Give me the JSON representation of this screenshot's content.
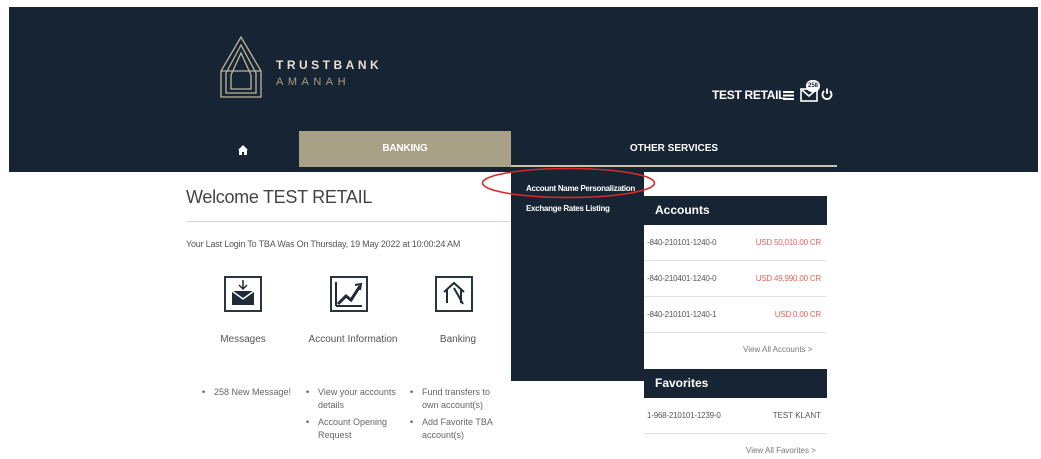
{
  "brand": {
    "line1": "TRUSTBANK",
    "line2": "AMANAH"
  },
  "header": {
    "user_name": "TEST RETAIL",
    "mail_count": "258"
  },
  "nav": {
    "banking": "BANKING",
    "other_services": "OTHER SERVICES"
  },
  "dropdown": {
    "items": [
      "Account Name Personalization",
      "Exchange Rates Listing"
    ]
  },
  "welcome": {
    "title": "Welcome TEST RETAIL",
    "last_login": "Your Last Login To TBA Was On Thursday, 19 May 2022 at 10:00:24 AM"
  },
  "tiles": [
    {
      "label": "Messages",
      "icon": "messages-icon",
      "bullets": [
        "258 New Message!"
      ]
    },
    {
      "label": "Account Information",
      "icon": "account-chart-icon",
      "bullets": [
        "View your accounts details",
        "Account Opening Request"
      ]
    },
    {
      "label": "Banking",
      "icon": "banking-icon",
      "bullets": [
        "Fund transfers to own account(s)",
        "Add Favorite TBA account(s)"
      ]
    }
  ],
  "accounts": {
    "title": "Accounts",
    "rows": [
      {
        "number": "-840-210101-1240-0",
        "balance": "USD 50,010.00 CR"
      },
      {
        "number": "-840-210401-1240-0",
        "balance": "USD 49,990.00 CR"
      },
      {
        "number": "-840-210101-1240-1",
        "balance": "USD 0.00 CR"
      }
    ],
    "view_all": "View All Accounts  >"
  },
  "favorites": {
    "title": "Favorites",
    "rows": [
      {
        "number": "1-968-210101-1239-0",
        "name": "TEST KLANT"
      }
    ],
    "view_all": "View All Favorites  >"
  },
  "colors": {
    "navy": "#162433",
    "gold": "#a9a185",
    "balance_red": "#e0665a",
    "highlight": "#d62a2a"
  }
}
